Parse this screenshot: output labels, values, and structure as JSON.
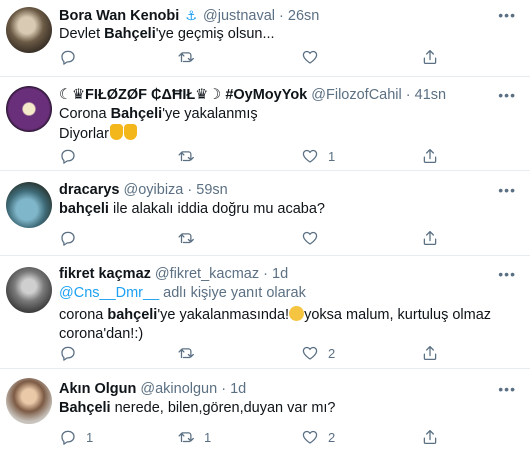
{
  "icons": {
    "reply": "comment-icon",
    "retweet": "retweet-icon",
    "like": "heart-icon",
    "share": "share-icon",
    "more": "more-icon"
  },
  "colors": {
    "accent": "#1da1f2",
    "muted": "#5b7083",
    "text": "#0f1419",
    "divider": "#e6ecf0"
  },
  "tweets": [
    {
      "name": "Bora Wan Kenobi",
      "badge": "⚓",
      "handle": "@justnaval",
      "dot": "·",
      "time": "26sn",
      "text_parts": [
        "Devlet ",
        "Bahçeli",
        "'ye geçmiş olsun..."
      ],
      "actions": {
        "reply": "",
        "retweet": "",
        "like": ""
      }
    },
    {
      "name": "☾♛FIŁØZØF ₵ΔĦIŁ♛☽ #OyMoyYok",
      "handle": "@FilozofCahil",
      "dot": "·",
      "time": "41sn",
      "text_parts": [
        "Corona ",
        "Bahçeli",
        "'ye yakalanmış"
      ],
      "text_line2": "Diyorlar",
      "actions": {
        "reply": "",
        "retweet": "",
        "like": "1"
      }
    },
    {
      "name": "dracarys",
      "handle": "@oyibiza",
      "dot": "·",
      "time": "59sn",
      "text_parts": [
        "bahçeli",
        " ile alakalı iddia doğru mu acaba?"
      ],
      "actions": {
        "reply": "",
        "retweet": "",
        "like": ""
      }
    },
    {
      "name": "fikret kaçmaz",
      "handle": "@fikret_kacmaz",
      "dot": "·",
      "time": "1d",
      "reply_mention": "@Cns__Dmr__",
      "reply_suffix": " adlı kişiye yanıt olarak",
      "text_parts": [
        "corona ",
        "bahçeli",
        "'ye yakalanmasında!",
        "yoksa malum, kurtuluş olmaz"
      ],
      "text_line2": "corona'dan!:)",
      "actions": {
        "reply": "",
        "retweet": "",
        "like": "2"
      }
    },
    {
      "name": "Akın Olgun",
      "handle": "@akinolgun",
      "dot": "·",
      "time": "1d",
      "text_parts": [
        "Bahçeli",
        " nerede, bilen,gören,duyan var mı?"
      ],
      "actions": {
        "reply": "1",
        "retweet": "1",
        "like": "2"
      }
    }
  ]
}
